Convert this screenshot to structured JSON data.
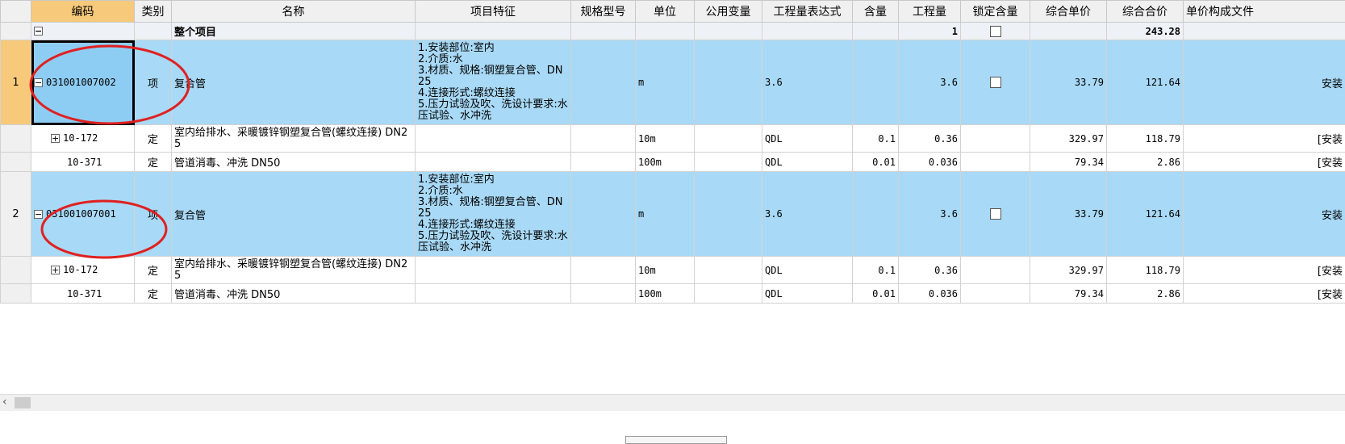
{
  "headers": [
    "编码",
    "类别",
    "名称",
    "项目特征",
    "规格型号",
    "单位",
    "公用变量",
    "工程量表达式",
    "含量",
    "工程量",
    "锁定含量",
    "综合单价",
    "综合合价",
    "单价构成文件"
  ],
  "total_row": {
    "expand": "−",
    "name": "整个项目",
    "quantity": "1",
    "total_price": "243.28"
  },
  "rows": [
    {
      "row_no": "1",
      "code": "031001007002",
      "type": "项",
      "name": "复合管",
      "features": "1.安装部位:室内\n2.介质:水\n3.材质、规格:钢塑复合管、DN25\n4.连接形式:螺纹连接\n5.压力试验及吹、洗设计要求:水压试验、水冲洗",
      "unit": "m",
      "expr": "3.6",
      "quantity": "3.6",
      "unit_price": "33.79",
      "total_price": "121.64",
      "file": "安装",
      "children": [
        {
          "code": "10-172",
          "type": "定",
          "name": "室内给排水、采暖镀锌钢塑复合管(螺纹连接) DN25",
          "unit": "10m",
          "expr": "QDL",
          "content": "0.1",
          "quantity": "0.36",
          "unit_price": "329.97",
          "total_price": "118.79",
          "file": "[安装"
        },
        {
          "code": "10-371",
          "type": "定",
          "name": "管道消毒、冲洗 DN50",
          "unit": "100m",
          "expr": "QDL",
          "content": "0.01",
          "quantity": "0.036",
          "unit_price": "79.34",
          "total_price": "2.86",
          "file": "[安装"
        }
      ]
    },
    {
      "row_no": "2",
      "code": "031001007001",
      "type": "项",
      "name": "复合管",
      "features": "1.安装部位:室内\n2.介质:水\n3.材质、规格:钢塑复合管、DN25\n4.连接形式:螺纹连接\n5.压力试验及吹、洗设计要求:水压试验、水冲洗",
      "unit": "m",
      "expr": "3.6",
      "quantity": "3.6",
      "unit_price": "33.79",
      "total_price": "121.64",
      "file": "安装",
      "children": [
        {
          "code": "10-172",
          "type": "定",
          "name": "室内给排水、采暖镀锌钢塑复合管(螺纹连接) DN25",
          "unit": "10m",
          "expr": "QDL",
          "content": "0.1",
          "quantity": "0.36",
          "unit_price": "329.97",
          "total_price": "118.79",
          "file": "[安装"
        },
        {
          "code": "10-371",
          "type": "定",
          "name": "管道消毒、冲洗 DN50",
          "unit": "100m",
          "expr": "QDL",
          "content": "0.01",
          "quantity": "0.036",
          "unit_price": "79.34",
          "total_price": "2.86",
          "file": "[安装"
        }
      ]
    }
  ],
  "icons": {
    "expanded": "−",
    "collapsed": "+",
    "scroll_left": "‹"
  },
  "colors": {
    "header_selected": "#f7c97a",
    "row_selected": "#a8d9f6",
    "annotation": "#e02020"
  }
}
